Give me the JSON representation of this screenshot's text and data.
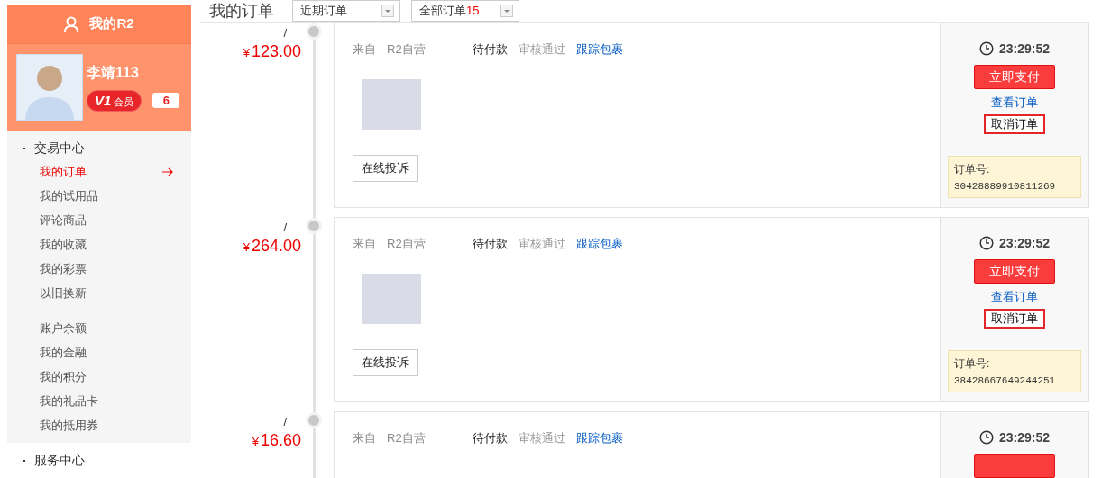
{
  "sidebar": {
    "title": "我的R2",
    "user": {
      "name": "李靖113",
      "level": "V1",
      "level_label": "会员",
      "messages": "6"
    },
    "sections": [
      {
        "title": "交易中心",
        "groups": [
          [
            {
              "label": "我的订单",
              "selected": true
            },
            {
              "label": "我的试用品",
              "selected": false
            },
            {
              "label": "评论商品",
              "selected": false
            },
            {
              "label": "我的收藏",
              "selected": false
            },
            {
              "label": "我的彩票",
              "selected": false
            },
            {
              "label": "以旧换新",
              "selected": false
            }
          ],
          [
            {
              "label": "账户余额",
              "selected": false
            },
            {
              "label": "我的金融",
              "selected": false
            },
            {
              "label": "我的积分",
              "selected": false
            },
            {
              "label": "我的礼品卡",
              "selected": false
            },
            {
              "label": "我的抵用券",
              "selected": false
            }
          ]
        ]
      },
      {
        "title": "服务中心"
      }
    ]
  },
  "page_title": "我的订单",
  "filters": [
    {
      "label": "近期订单"
    },
    {
      "label": "全部订单",
      "count": "15"
    }
  ],
  "orders": [
    {
      "kind": "full",
      "slash": "/",
      "currency": "¥",
      "amount": "123.00",
      "from_label": "来自",
      "seller": "R2自营",
      "statuses": [
        {
          "label": "待付款",
          "kind": "current"
        },
        {
          "label": "审核通过",
          "kind": "done"
        },
        {
          "label": "跟踪包裹",
          "kind": "link"
        }
      ],
      "complaint": "在线投诉",
      "time": "23:29:52",
      "pay": "立即支付",
      "view": "查看订单",
      "cancel": "取消订单",
      "order_no_label": "订单号:",
      "order_no": "30428889910811269"
    },
    {
      "kind": "full",
      "slash": "/",
      "currency": "¥",
      "amount": "264.00",
      "from_label": "来自",
      "seller": "R2自营",
      "statuses": [
        {
          "label": "待付款",
          "kind": "current"
        },
        {
          "label": "审核通过",
          "kind": "done"
        },
        {
          "label": "跟踪包裹",
          "kind": "link"
        }
      ],
      "complaint": "在线投诉",
      "time": "23:29:52",
      "pay": "立即支付",
      "view": "查看订单",
      "cancel": "取消订单",
      "order_no_label": "订单号:",
      "order_no": "38428667649244251"
    },
    {
      "kind": "cut",
      "slash": "/",
      "currency": "¥",
      "amount": "16.60",
      "from_label": "来自",
      "seller": "R2自营",
      "statuses": [
        {
          "label": "待付款",
          "kind": "current"
        },
        {
          "label": "审核通过",
          "kind": "done"
        },
        {
          "label": "跟踪包裹",
          "kind": "link"
        }
      ],
      "time": "23:29:52"
    }
  ]
}
